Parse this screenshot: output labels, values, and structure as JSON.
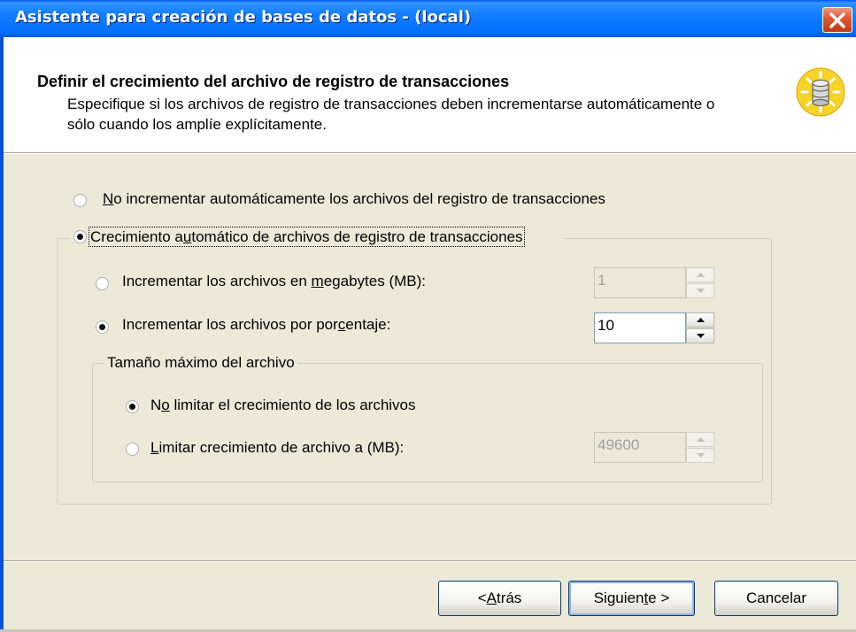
{
  "window": {
    "title": "Asistente para creación de bases de datos - (local)"
  },
  "header": {
    "title": "Definir el crecimiento del archivo de registro de transacciones",
    "description": "Especifique si los archivos de registro de transacciones deben incrementarse automáticamente o sólo cuando los amplíe explícitamente.",
    "icon": "database-icon"
  },
  "options": {
    "no_auto_grow": {
      "pre": "",
      "key": "N",
      "post": "o incrementar automáticamente los archivos del registro de transacciones",
      "selected": false
    },
    "auto_grow": {
      "pre": "Crecimiento a",
      "key": "u",
      "post": "tomático de archivos de registro de transacciones",
      "selected": true
    },
    "grow_mb": {
      "pre": "Incrementar los archivos en ",
      "key": "m",
      "post": "egabytes (MB):",
      "selected": false,
      "value": "1",
      "enabled": false
    },
    "grow_percent": {
      "pre": "Incrementar los archivos por por",
      "key": "c",
      "post": "entaje:",
      "selected": true,
      "value": "10",
      "enabled": true
    }
  },
  "max_size": {
    "group_label": "Tamaño máximo del archivo",
    "unlimited": {
      "pre": "N",
      "key": "o",
      "post": " limitar el crecimiento de los archivos",
      "selected": true
    },
    "limit": {
      "pre": "",
      "key": "L",
      "post": "imitar crecimiento de archivo a (MB):",
      "selected": false,
      "value": "49600",
      "enabled": false
    }
  },
  "buttons": {
    "back": {
      "pre": "< ",
      "key": "A",
      "post": "trás"
    },
    "next": {
      "pre": "Siguien",
      "key": "t",
      "post": "e >"
    },
    "cancel": "Cancelar"
  },
  "colors": {
    "title_bar": "#036ffc",
    "close_button": "#e0552d",
    "dialog_bg": "#ece9d8",
    "accent": "#003c74"
  }
}
